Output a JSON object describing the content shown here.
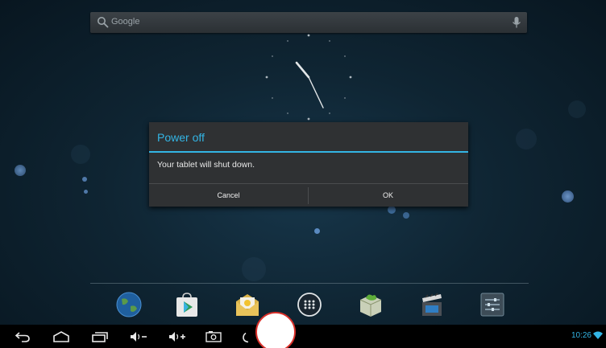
{
  "search": {
    "placeholder": "Google",
    "icon": "search-icon",
    "voice_icon": "mic-icon"
  },
  "clock": {
    "type": "analog",
    "hour_hand_angle": 330,
    "minute_hand_angle": 150
  },
  "dialog": {
    "title": "Power off",
    "message": "Your tablet will shut down.",
    "cancel_label": "Cancel",
    "ok_label": "OK",
    "accent_color": "#33b5e5"
  },
  "dock": {
    "items": [
      {
        "name": "browser-icon"
      },
      {
        "name": "play-store-icon"
      },
      {
        "name": "email-icon"
      },
      {
        "name": "all-apps-icon"
      },
      {
        "name": "app-installer-icon"
      },
      {
        "name": "video-player-icon"
      },
      {
        "name": "settings-icon"
      }
    ]
  },
  "navbar": {
    "icons": [
      "back-icon",
      "home-icon",
      "recent-apps-icon",
      "volume-down-icon",
      "volume-up-icon",
      "screenshot-icon",
      "power-icon"
    ],
    "time": "10:26",
    "status_icon": "wifi-icon"
  },
  "colors": {
    "accent": "#33b5e5",
    "dialog_bg": "#2f3133",
    "navbar_bg": "#000000"
  }
}
